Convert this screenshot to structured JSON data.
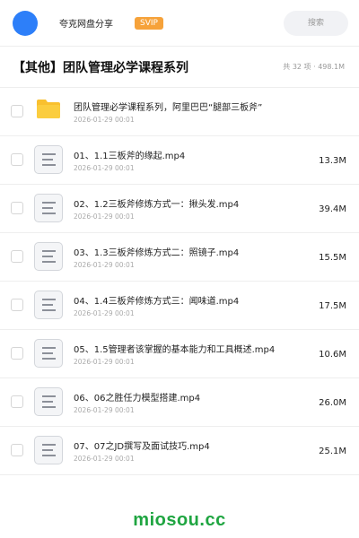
{
  "header": {
    "app_title": "夸克网盘分享",
    "badge": "SVIP",
    "search_placeholder": "搜索"
  },
  "folder": {
    "title": "【其他】团队管理必学课程系列",
    "meta": "共 32 项 · 498.1M"
  },
  "files": [
    {
      "name": "团队管理必学课程系列，阿里巴巴“腿部三板斧”",
      "date": "2026-01-29 00:01",
      "size": "",
      "type": "folder"
    },
    {
      "name": "01、1.1三板斧的缘起.mp4",
      "date": "2026-01-29 00:01",
      "size": "13.3M",
      "type": "file"
    },
    {
      "name": "02、1.2三板斧修炼方式一：揪头发.mp4",
      "date": "2026-01-29 00:01",
      "size": "39.4M",
      "type": "file"
    },
    {
      "name": "03、1.3三板斧修炼方式二：照镜子.mp4",
      "date": "2026-01-29 00:01",
      "size": "15.5M",
      "type": "file"
    },
    {
      "name": "04、1.4三板斧修炼方式三：闻味道.mp4",
      "date": "2026-01-29 00:01",
      "size": "17.5M",
      "type": "file"
    },
    {
      "name": "05、1.5管理者该掌握的基本能力和工具概述.mp4",
      "date": "2026-01-29 00:01",
      "size": "10.6M",
      "type": "file"
    },
    {
      "name": "06、06之胜任力模型搭建.mp4",
      "date": "2026-01-29 00:01",
      "size": "26.0M",
      "type": "file"
    },
    {
      "name": "07、07之JD撰写及面试技巧.mp4",
      "date": "2026-01-29 00:01",
      "size": "25.1M",
      "type": "file"
    }
  ],
  "watermark": "miosou.cc",
  "colors": {
    "accent": "#2d7ff9",
    "badge": "#f6a23a",
    "folder": "#f9c02f",
    "watermark": "#1fa541"
  }
}
